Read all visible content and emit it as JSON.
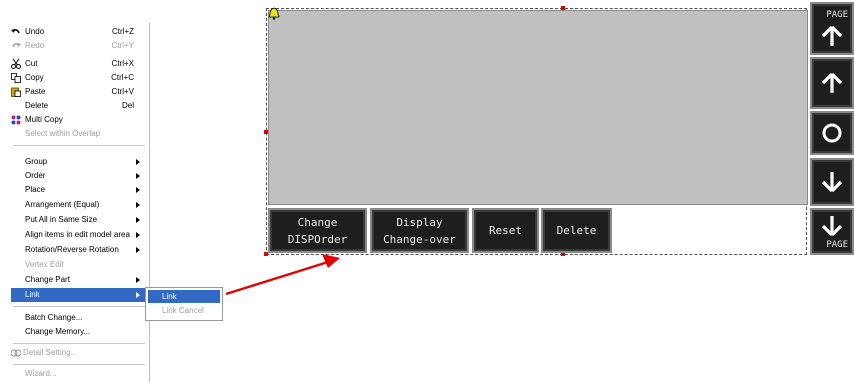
{
  "menu": {
    "items": [
      {
        "label": "Undo",
        "shortcut": "Ctrl+Z",
        "icon": "undo-icon"
      },
      {
        "label": "Redo",
        "shortcut": "Ctrl+Y",
        "icon": "redo-icon"
      },
      {
        "label": "Cut",
        "shortcut": "Ctrl+X",
        "icon": "scissors-icon"
      },
      {
        "label": "Copy",
        "shortcut": "Ctrl+C",
        "icon": "copy-icon"
      },
      {
        "label": "Paste",
        "shortcut": "Ctrl+V",
        "icon": "paste-icon"
      },
      {
        "label": "Delete",
        "shortcut": "Del"
      },
      {
        "label": "Multi Copy",
        "icon": "multi-copy-icon"
      },
      {
        "label": "Select within Overlap"
      },
      {
        "label": "Group"
      },
      {
        "label": "Order"
      },
      {
        "label": "Place"
      },
      {
        "label": "Arrangement (Equal)"
      },
      {
        "label": "Put All in Same Size"
      },
      {
        "label": "Align items in edit model area"
      },
      {
        "label": "Rotation/Reverse Rotation"
      },
      {
        "label": "Vertex Edit"
      },
      {
        "label": "Change Part"
      },
      {
        "label": "Link"
      },
      {
        "label": "Batch Change..."
      },
      {
        "label": "Change Memory..."
      },
      {
        "label": "Detail Setting...",
        "icon": "detail-setting-icon"
      },
      {
        "label": "Wizard..."
      }
    ]
  },
  "submenu": {
    "link": "Link",
    "link_cancel": "Link Cancel"
  },
  "panel": {
    "buttons": [
      {
        "line1": "Change",
        "line2": "DISPOrder"
      },
      {
        "line1": "Display",
        "line2": "Change-over"
      },
      {
        "line1": "Reset"
      },
      {
        "line1": "Delete"
      }
    ],
    "side": {
      "page_up": "PAGE",
      "page_down": "PAGE"
    }
  },
  "colors": {
    "highlight": "#316ac5",
    "screen": "#c0c0c0",
    "button_bg": "#1e1e1e",
    "annotation_arrow": "#e00000"
  }
}
